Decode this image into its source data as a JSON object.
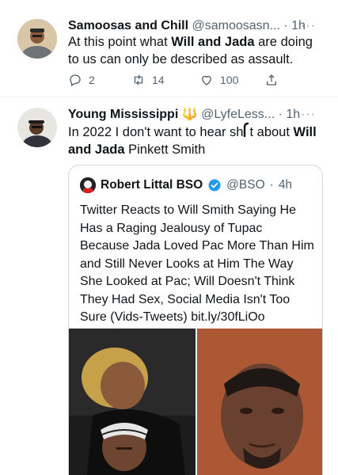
{
  "tweets": [
    {
      "name": "Samoosas and Chill",
      "handle": "@samoosasn...",
      "dot": "·",
      "time": "1h",
      "more": "···",
      "text_before": "At this point what ",
      "text_bold": "Will and Jada",
      "text_after": " are doing to us can only be described as assault.",
      "actions": {
        "replies": "2",
        "retweets": "14",
        "likes": "100"
      }
    },
    {
      "name": "Young Mississippi",
      "handle": "@LyfeLess...",
      "dot": "·",
      "time": "1h",
      "more": "···",
      "badge": "🔱",
      "text_before": "In 2022 I don't want to hear sh",
      "text_mid": "t about ",
      "text_bold": "Will and Jada",
      "text_after": " Pinkett Smith"
    }
  ],
  "quote": {
    "name": "Robert Littal BSO",
    "handle": "@BSO",
    "dot": "·",
    "time": "4h",
    "text": "Twitter Reacts to Will Smith Saying He Has a Raging Jealousy of Tupac Because Jada Loved Pac More Than Him and Still Never Looks at Him The Way She Looked at Pac; Will Doesn't Think They Had Sex, Social Media Isn't Too Sure (Vids-Tweets) bit.ly/30fLiOo"
  },
  "colors": {
    "verified": "#1d9bf0",
    "muted": "#536471",
    "divider": "#eff3f4",
    "trident": "#f4a300"
  },
  "icons": [
    "reply-icon",
    "retweet-icon",
    "like-icon",
    "share-icon",
    "verified-badge-icon",
    "trident-emoji-icon"
  ]
}
